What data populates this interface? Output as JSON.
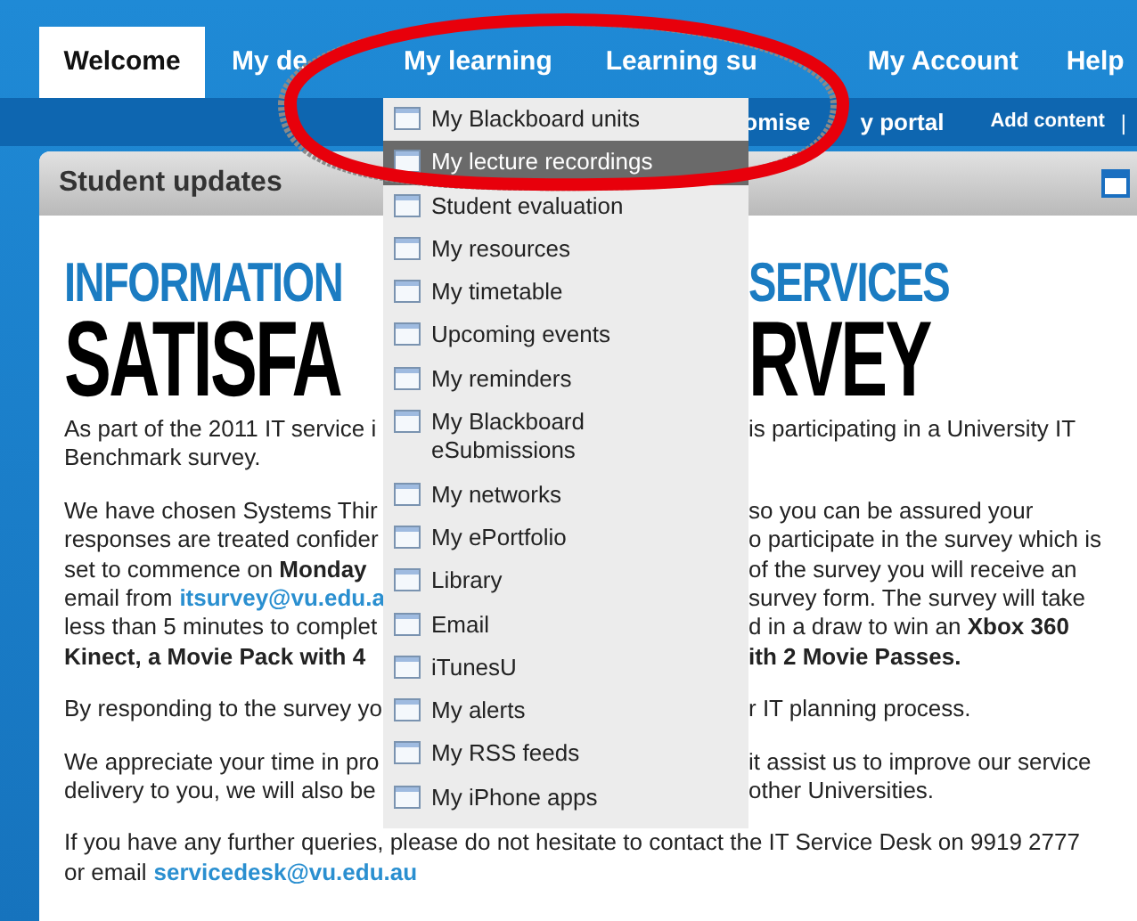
{
  "tabs": [
    {
      "label": "Welcome",
      "selected": true
    },
    {
      "label": "My de",
      "selected": false
    },
    {
      "label": "My learning",
      "selected": false
    },
    {
      "label": "Learning su",
      "selected": false
    },
    {
      "label": "My Account",
      "selected": false
    },
    {
      "label": "Help",
      "selected": false
    }
  ],
  "subnav": [
    {
      "label": "omise",
      "kind": "link"
    },
    {
      "label": "y portal",
      "kind": "link"
    },
    {
      "label": "Add content",
      "kind": "link"
    },
    {
      "label": "|",
      "kind": "separator"
    }
  ],
  "panel": {
    "title": "Student updates"
  },
  "banner": [
    {
      "left": "INFORMATION",
      "right": "SERVICES",
      "kind": "subtitle"
    },
    {
      "left": "SATISFA",
      "right": "RVEY",
      "kind": "title"
    }
  ],
  "paragraphs": [
    {
      "lines": [
        {
          "left": [
            {
              "text": "As part of the 2011 IT service i",
              "kind": "text"
            }
          ],
          "right": [
            {
              "text": "is participating in a University IT",
              "kind": "text"
            }
          ]
        },
        {
          "left": [
            {
              "text": "Benchmark survey.",
              "kind": "text"
            }
          ]
        }
      ]
    },
    {
      "lines": [
        {
          "left": [
            {
              "text": "We have chosen Systems Thir",
              "kind": "text"
            }
          ],
          "right": [
            {
              "text": "so you can be assured your",
              "kind": "text"
            }
          ]
        },
        {
          "left": [
            {
              "text": "responses are treated confider",
              "kind": "text"
            }
          ],
          "right": [
            {
              "text": "o participate in the survey which is",
              "kind": "text"
            }
          ]
        },
        {
          "left": [
            {
              "text": "set to commence on **Monday**",
              "kind": "text"
            }
          ],
          "right": [
            {
              "text": "of the survey you will receive an",
              "kind": "text"
            }
          ]
        },
        {
          "left": [
            {
              "text": "email from",
              "kind": "text"
            },
            {
              "text": "itsurvey@vu.edu.a",
              "kind": "link"
            }
          ],
          "right": [
            {
              "text": "survey form. The survey will take",
              "kind": "text"
            }
          ]
        },
        {
          "left": [
            {
              "text": "less than 5 minutes to complet",
              "kind": "text"
            }
          ],
          "right": [
            {
              "text": "d in a draw to win an **Xbox 360**",
              "kind": "text"
            }
          ]
        },
        {
          "left": [
            {
              "text": "Kinect, a Movie Pack with 4",
              "kind": "bold"
            }
          ],
          "right": [
            {
              "text": "ith 2 Movie Passes.",
              "kind": "bold"
            }
          ]
        }
      ]
    },
    {
      "lines": [
        {
          "left": [
            {
              "text": "By responding to the survey yo",
              "kind": "text"
            }
          ],
          "right": [
            {
              "text": "r IT planning process.",
              "kind": "text"
            }
          ]
        }
      ]
    },
    {
      "lines": [
        {
          "left": [
            {
              "text": "We appreciate your time in pro",
              "kind": "text"
            }
          ],
          "right": [
            {
              "text": "it assist us to improve our service",
              "kind": "text"
            }
          ]
        },
        {
          "left": [
            {
              "text": "delivery to you, we will also be",
              "kind": "text"
            }
          ],
          "right": [
            {
              "text": "other Universities.",
              "kind": "text"
            }
          ]
        }
      ]
    },
    {
      "lines": [
        {
          "full": [
            {
              "text": "If you have any further queries, please do not hesitate to contact the IT Service Desk on 9919 2777",
              "kind": "text"
            }
          ]
        },
        {
          "full": [
            {
              "text": "or email",
              "kind": "text"
            },
            {
              "text": "servicedesk@vu.edu.au",
              "kind": "link"
            }
          ]
        }
      ]
    }
  ],
  "menu": {
    "items": [
      {
        "label": "My Blackboard units",
        "selected": false
      },
      {
        "label": "My lecture recordings",
        "selected": true
      },
      {
        "label": "Student evaluation",
        "selected": false
      },
      {
        "label": "My resources",
        "selected": false
      },
      {
        "label": "My timetable",
        "selected": false
      },
      {
        "label": "Upcoming events",
        "selected": false
      },
      {
        "label": "My reminders",
        "selected": false
      },
      {
        "label": "My Blackboard eSubmissions",
        "selected": false
      },
      {
        "label": "My networks",
        "selected": false
      },
      {
        "label": "My ePortfolio",
        "selected": false
      },
      {
        "label": "Library",
        "selected": false
      },
      {
        "label": "Email",
        "selected": false
      },
      {
        "label": "iTunesU",
        "selected": false
      },
      {
        "label": "My alerts",
        "selected": false
      },
      {
        "label": "My RSS feeds",
        "selected": false
      },
      {
        "label": "My iPhone apps",
        "selected": false
      }
    ]
  }
}
